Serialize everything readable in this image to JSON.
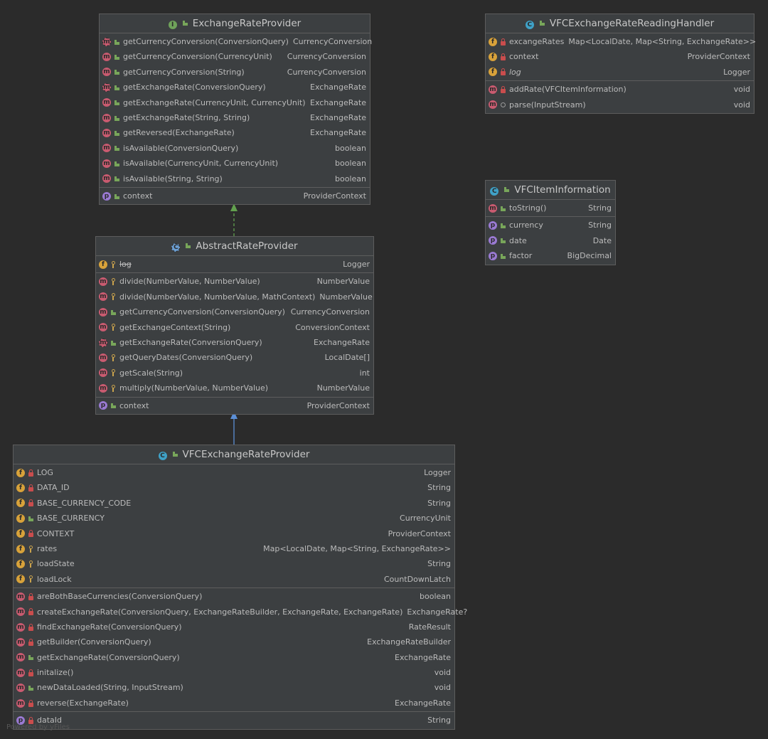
{
  "classes": {
    "exchange_rate_provider": {
      "kind": "I",
      "name": "ExchangeRateProvider",
      "sections": [
        [
          {
            "kind": "m",
            "abstract": true,
            "vis": "public",
            "name": "getCurrencyConversion(ConversionQuery)",
            "type": "CurrencyConversion"
          },
          {
            "kind": "m",
            "vis": "public",
            "name": "getCurrencyConversion(CurrencyUnit)",
            "type": "CurrencyConversion"
          },
          {
            "kind": "m",
            "vis": "public",
            "name": "getCurrencyConversion(String)",
            "type": "CurrencyConversion"
          },
          {
            "kind": "m",
            "abstract": true,
            "vis": "public",
            "name": "getExchangeRate(ConversionQuery)",
            "type": "ExchangeRate"
          },
          {
            "kind": "m",
            "vis": "public",
            "name": "getExchangeRate(CurrencyUnit, CurrencyUnit)",
            "type": "ExchangeRate"
          },
          {
            "kind": "m",
            "vis": "public",
            "name": "getExchangeRate(String, String)",
            "type": "ExchangeRate"
          },
          {
            "kind": "m",
            "vis": "public",
            "name": "getReversed(ExchangeRate)",
            "type": "ExchangeRate"
          },
          {
            "kind": "m",
            "vis": "public",
            "name": "isAvailable(ConversionQuery)",
            "type": "boolean"
          },
          {
            "kind": "m",
            "vis": "public",
            "name": "isAvailable(CurrencyUnit, CurrencyUnit)",
            "type": "boolean"
          },
          {
            "kind": "m",
            "vis": "public",
            "name": "isAvailable(String, String)",
            "type": "boolean"
          }
        ],
        [
          {
            "kind": "p",
            "vis": "public",
            "name": "context",
            "type": "ProviderContext"
          }
        ]
      ]
    },
    "abstract_rate_provider": {
      "kind": "C",
      "abstract_class": true,
      "name": "AbstractRateProvider",
      "sections": [
        [
          {
            "kind": "f",
            "vis": "protected",
            "name": "log",
            "strike": true,
            "type": "Logger"
          }
        ],
        [
          {
            "kind": "m",
            "vis": "protected",
            "name": "divide(NumberValue, NumberValue)",
            "type": "NumberValue"
          },
          {
            "kind": "m",
            "vis": "protected",
            "name": "divide(NumberValue, NumberValue, MathContext)",
            "type": "NumberValue"
          },
          {
            "kind": "m",
            "vis": "public",
            "name": "getCurrencyConversion(ConversionQuery)",
            "type": "CurrencyConversion"
          },
          {
            "kind": "m",
            "vis": "protected",
            "name": "getExchangeContext(String)",
            "type": "ConversionContext"
          },
          {
            "kind": "m",
            "abstract": true,
            "vis": "public",
            "name": "getExchangeRate(ConversionQuery)",
            "type": "ExchangeRate"
          },
          {
            "kind": "m",
            "vis": "protected",
            "name": "getQueryDates(ConversionQuery)",
            "type": "LocalDate[]"
          },
          {
            "kind": "m",
            "vis": "protected",
            "name": "getScale(String)",
            "type": "int"
          },
          {
            "kind": "m",
            "vis": "protected",
            "name": "multiply(NumberValue, NumberValue)",
            "type": "NumberValue"
          }
        ],
        [
          {
            "kind": "p",
            "vis": "public",
            "name": "context",
            "type": "ProviderContext"
          }
        ]
      ]
    },
    "vfc_exchange_rate_provider": {
      "kind": "C",
      "name": "VFCExchangeRateProvider",
      "sections": [
        [
          {
            "kind": "f",
            "vis": "private",
            "name": "LOG",
            "type": "Logger"
          },
          {
            "kind": "f",
            "vis": "private",
            "name": "DATA_ID",
            "type": "String"
          },
          {
            "kind": "f",
            "vis": "private",
            "name": "BASE_CURRENCY_CODE",
            "type": "String"
          },
          {
            "kind": "f",
            "vis": "public",
            "name": "BASE_CURRENCY",
            "type": "CurrencyUnit"
          },
          {
            "kind": "f",
            "vis": "private",
            "name": "CONTEXT",
            "type": "ProviderContext"
          },
          {
            "kind": "f",
            "vis": "protected",
            "name": "rates",
            "type": "Map<LocalDate, Map<String, ExchangeRate>>"
          },
          {
            "kind": "f",
            "vis": "protected",
            "name": "loadState",
            "type": "String"
          },
          {
            "kind": "f",
            "vis": "protected",
            "name": "loadLock",
            "type": "CountDownLatch"
          }
        ],
        [
          {
            "kind": "m",
            "vis": "private",
            "name": "areBothBaseCurrencies(ConversionQuery)",
            "type": "boolean"
          },
          {
            "kind": "m",
            "vis": "private",
            "name": "createExchangeRate(ConversionQuery, ExchangeRateBuilder, ExchangeRate, ExchangeRate)",
            "type": "ExchangeRate?"
          },
          {
            "kind": "m",
            "vis": "private",
            "name": "findExchangeRate(ConversionQuery)",
            "type": "RateResult"
          },
          {
            "kind": "m",
            "vis": "private",
            "name": "getBuilder(ConversionQuery)",
            "type": "ExchangeRateBuilder"
          },
          {
            "kind": "m",
            "vis": "public",
            "name": "getExchangeRate(ConversionQuery)",
            "type": "ExchangeRate"
          },
          {
            "kind": "m",
            "vis": "private",
            "name": "initalize()",
            "type": "void"
          },
          {
            "kind": "m",
            "vis": "public",
            "name": "newDataLoaded(String, InputStream)",
            "type": "void"
          },
          {
            "kind": "m",
            "vis": "private",
            "name": "reverse(ExchangeRate)",
            "type": "ExchangeRate"
          }
        ],
        [
          {
            "kind": "p",
            "vis": "private",
            "name": "dataId",
            "type": "String"
          }
        ]
      ]
    },
    "vfc_exchange_rate_reading_handler": {
      "kind": "C",
      "name": "VFCExchangeRateReadingHandler",
      "sections": [
        [
          {
            "kind": "f",
            "vis": "private",
            "name": "excangeRates",
            "type": "Map<LocalDate, Map<String, ExchangeRate>>"
          },
          {
            "kind": "f",
            "vis": "private",
            "name": "context",
            "type": "ProviderContext"
          },
          {
            "kind": "f",
            "vis": "private",
            "name": "log",
            "italic": true,
            "type": "Logger"
          }
        ],
        [
          {
            "kind": "m",
            "vis": "private",
            "name": "addRate(VFCItemInformation)",
            "type": "void"
          },
          {
            "kind": "m",
            "vis": "package",
            "name": "parse(InputStream)",
            "type": "void"
          }
        ]
      ]
    },
    "vfc_item_information": {
      "kind": "C",
      "name": "VFCItemInformation",
      "sections": [
        [
          {
            "kind": "m",
            "vis": "public",
            "name": "toString()",
            "type": "String"
          }
        ],
        [
          {
            "kind": "p",
            "vis": "public",
            "name": "currency",
            "type": "String"
          },
          {
            "kind": "p",
            "vis": "public",
            "name": "date",
            "type": "Date"
          },
          {
            "kind": "p",
            "vis": "public",
            "name": "factor",
            "type": "BigDecimal"
          }
        ]
      ]
    }
  },
  "colors": {
    "implements_arrow": "#62a04e",
    "extends_arrow": "#5b8fd6"
  },
  "footer": "Powered by yFiles"
}
